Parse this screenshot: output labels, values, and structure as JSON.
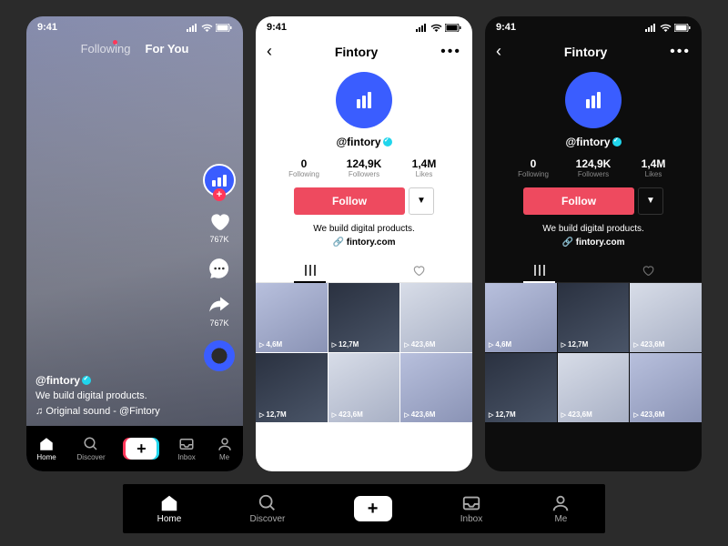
{
  "status": {
    "time": "9:41"
  },
  "feed": {
    "tab_following": "Following",
    "tab_for_you": "For You",
    "likes_count": "767K",
    "username": "@fintory",
    "bio": "We build digital products.",
    "sound": "Original sound - @Fintory"
  },
  "profile": {
    "title": "Fintory",
    "handle": "@fintory",
    "following_n": "0",
    "following_l": "Following",
    "followers_n": "124,9K",
    "followers_l": "Followers",
    "likes_n": "1,4M",
    "likes_l": "Likes",
    "follow_btn": "Follow",
    "bio": "We build digital products.",
    "link": "fintory.com",
    "videos": [
      "4,6M",
      "12,7M",
      "423,6M",
      "12,7M",
      "423,6M",
      "423,6M"
    ]
  },
  "tabs": {
    "home": "Home",
    "discover": "Discover",
    "inbox": "Inbox",
    "me": "Me"
  }
}
